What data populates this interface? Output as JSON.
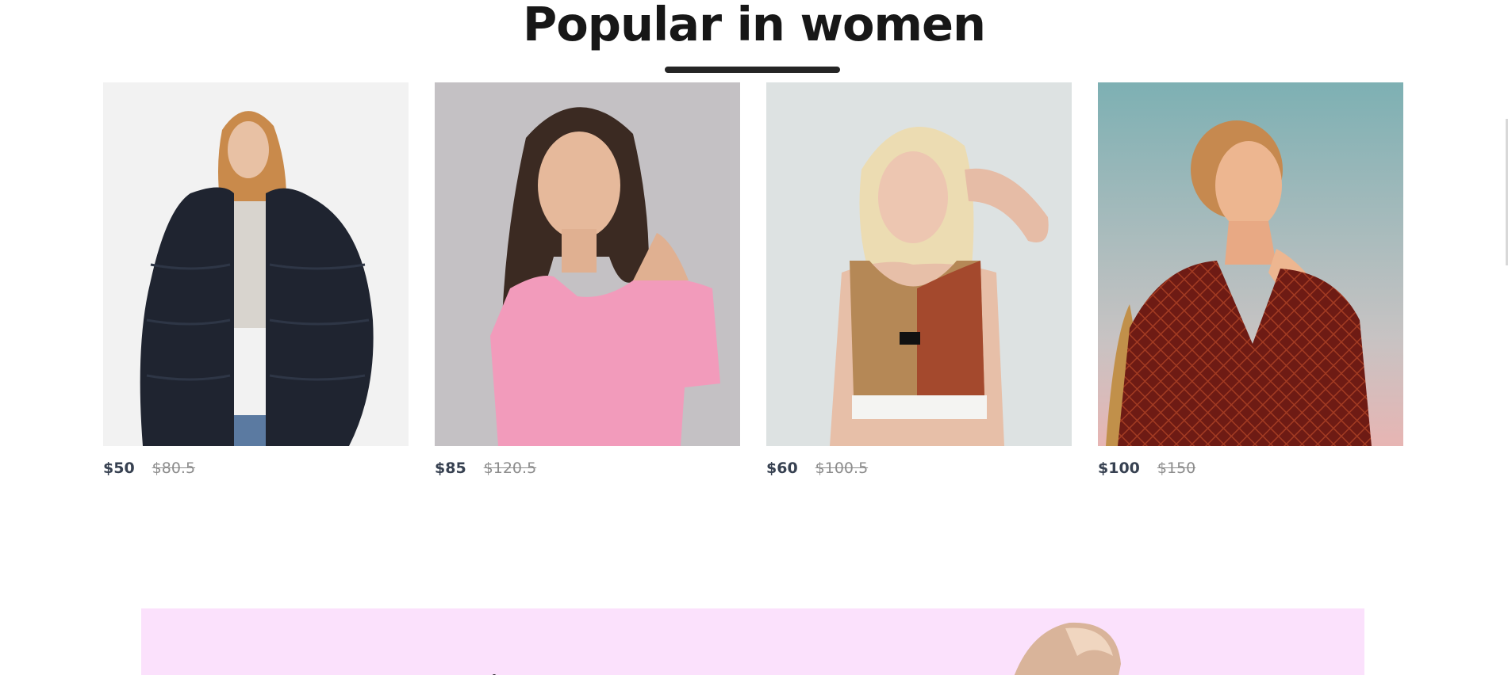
{
  "section": {
    "title": "Popular in women"
  },
  "products": [
    {
      "new_price": "$50",
      "old_price": "$80.5",
      "image": "woman-black-fur-jacket"
    },
    {
      "new_price": "$85",
      "old_price": "$120.5",
      "image": "woman-pink-square-neck-top"
    },
    {
      "new_price": "$60",
      "old_price": "$100.5",
      "image": "woman-two-tone-sports-crop-top"
    },
    {
      "new_price": "$100",
      "old_price": "$150",
      "image": "woman-red-patterned-wrap-dress"
    }
  ],
  "colors": {
    "title": "#171717",
    "underline": "#252525",
    "new_price": "#374151",
    "old_price": "#8c8c8c",
    "banner_bg": "#fbe1fc"
  }
}
